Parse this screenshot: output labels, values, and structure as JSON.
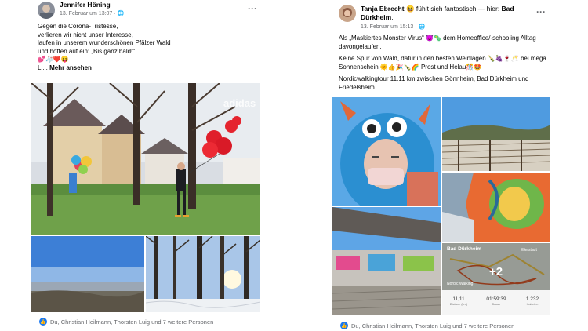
{
  "left_post": {
    "author": "Jennifer Höning",
    "timestamp": "13. Februar um 13:07 · ",
    "text_lines": [
      "Gegen die Corona-Tristesse,",
      "verlieren wir nicht unser Interesse,",
      "laufen in unserem wunderschönen Pfälzer Wald",
      "und hoffen auf ein: „Bis ganz bald!“",
      "💕🧦❤️😝"
    ],
    "truncated_prefix": "Li... ",
    "see_more": "Mehr ansehen",
    "reactions": "Du, Christian Heilmann, Thorsten Luig und 7 weitere Personen"
  },
  "right_post": {
    "author": "Tanja Ebrecht",
    "feeling": " 😆 fühlt sich fantastisch — hier: ",
    "place": "Bad Dürkheim",
    "place_end": ".",
    "timestamp": "13. Februar um 15:13 · ",
    "paragraph1": "Als „Maskiertes Monster Virus“ 😈🦠 dem Homeoffice/-schooling Alltag davongelaufen.",
    "paragraph2": "Keine Spur von Wald, dafür in den besten Weinlagen 🍾🍇🍷🥂 bei mega Sonnenschein 🌞👍🎉🍾🌈 Prost und Helau🎊🤩",
    "paragraph3": "Nordicwalkingtour 11.11 km zwischen Gönnheim, Bad Dürkheim und Friedelsheim.",
    "more_photos": "+2",
    "map_place": "Bad Dürkheim",
    "map_place2": "Ellerstadt",
    "map_activity": "Nordic Walking",
    "map_stats": [
      {
        "value": "11,11",
        "label": "Distanz (km)"
      },
      {
        "value": "01:59:39",
        "label": "Dauer"
      },
      {
        "value": "1.232",
        "label": "Kalorien"
      }
    ],
    "reactions": "Du, Christian Heilmann, Thorsten Luig und 7 weitere Personen"
  },
  "icons": {
    "globe": "globe-icon",
    "more": "more-options-icon",
    "like": "like-icon"
  },
  "colors": {
    "accent": "#1877f2",
    "meta": "#65676b"
  }
}
